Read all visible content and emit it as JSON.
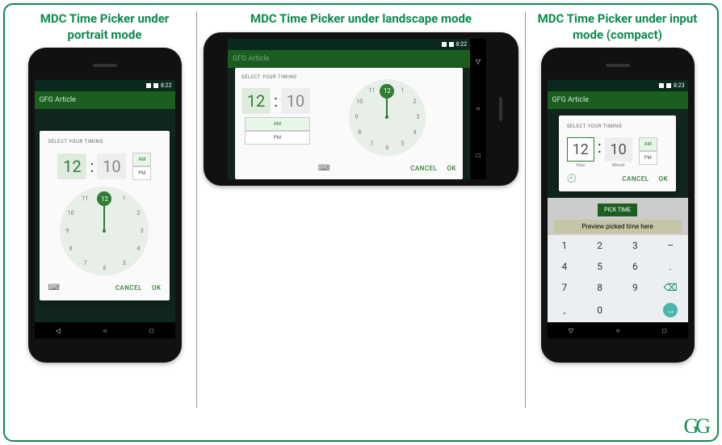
{
  "titles": {
    "portrait": "MDC Time Picker under portrait mode",
    "landscape": "MDC Time Picker under landscape mode",
    "input": "MDC Time Picker under input mode (compact)"
  },
  "status": {
    "time_a": "8:22",
    "time_b": "8:23"
  },
  "appbar": {
    "title": "GFG Article"
  },
  "picker": {
    "dialog_title": "SELECT YOUR TIMING",
    "hour": "12",
    "minute": "10",
    "colon": ":",
    "am": "AM",
    "pm": "PM",
    "cancel": "CANCEL",
    "ok": "OK",
    "hour_label": "Hour",
    "minute_label": "Minute"
  },
  "clock_numbers": [
    "12",
    "1",
    "2",
    "3",
    "4",
    "5",
    "6",
    "7",
    "8",
    "9",
    "10",
    "11"
  ],
  "clock_center_label": "12",
  "preview_text": "Preview picked time here",
  "chip": "PICK TIME",
  "keypad": [
    "1",
    "2",
    "3",
    "–",
    "4",
    "5",
    "6",
    ".",
    "7",
    "8",
    "9",
    "⌫",
    ",",
    "0",
    "",
    "→"
  ],
  "logo": "GG"
}
